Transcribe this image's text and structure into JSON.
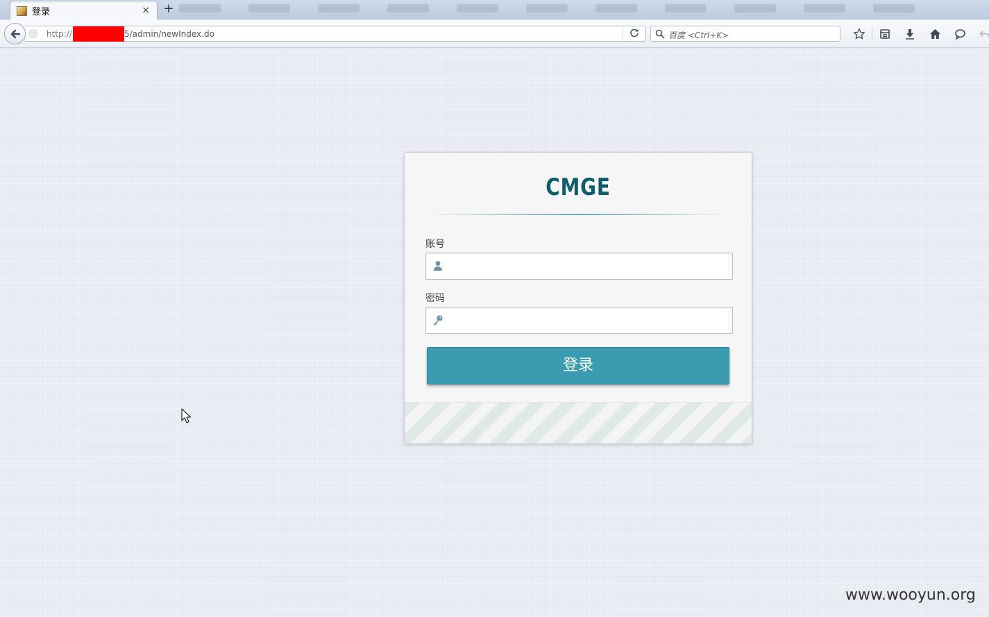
{
  "browser": {
    "active_tab": {
      "title": "登录",
      "close_glyph": "×",
      "favicon": "page-favicon-icon"
    },
    "new_tab_glyph": "+",
    "url": {
      "scheme": "http://",
      "path": "5/admin/newIndex.do"
    },
    "search": {
      "placeholder": "百度 <Ctrl+K>"
    },
    "toolbar": [
      "star-bookmark-icon",
      "reading-list-icon",
      "download-icon",
      "home-icon",
      "chat-icon",
      "undo-icon"
    ]
  },
  "login": {
    "brand": "CMGE",
    "account_label": "账号",
    "password_label": "密码",
    "submit_label": "登录"
  },
  "colors": {
    "accent": "#3b9bb1",
    "brand": "#0e5d6b"
  },
  "watermark": "www.wooyun.org"
}
